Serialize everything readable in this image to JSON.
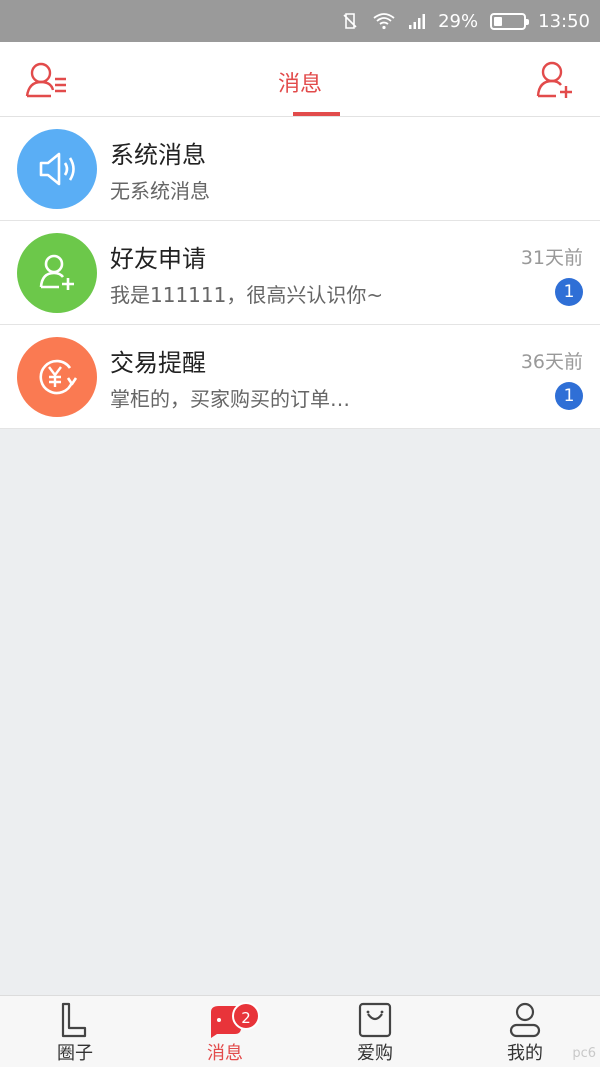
{
  "status_bar": {
    "battery": "29%",
    "battery_level": 0.29,
    "time": "13:50"
  },
  "header": {
    "title": "消息",
    "left_icon": "contacts-list-icon",
    "right_icon": "add-friend-icon",
    "accent": "#e24b4b"
  },
  "messages": [
    {
      "title": "系统消息",
      "subtitle": "无系统消息",
      "time": "",
      "badge": "",
      "icon": "speaker-icon",
      "color": "#5aaef5"
    },
    {
      "title": "好友申请",
      "subtitle": "我是111111，很高兴认识你~",
      "time": "31天前",
      "badge": "1",
      "icon": "add-user-icon",
      "color": "#6cc84a"
    },
    {
      "title": "交易提醒",
      "subtitle": "掌柜的，买家购买的订单…",
      "time": "36天前",
      "badge": "1",
      "icon": "yuan-refresh-icon",
      "color": "#fa7a52"
    }
  ],
  "bottom_nav": [
    {
      "label": "圈子",
      "icon": "circle-l-icon"
    },
    {
      "label": "消息",
      "icon": "chat-bubble-icon",
      "badge": "2",
      "active": true
    },
    {
      "label": "爱购",
      "icon": "shopping-bag-icon"
    },
    {
      "label": "我的",
      "icon": "person-icon"
    }
  ],
  "watermark": "pc6"
}
